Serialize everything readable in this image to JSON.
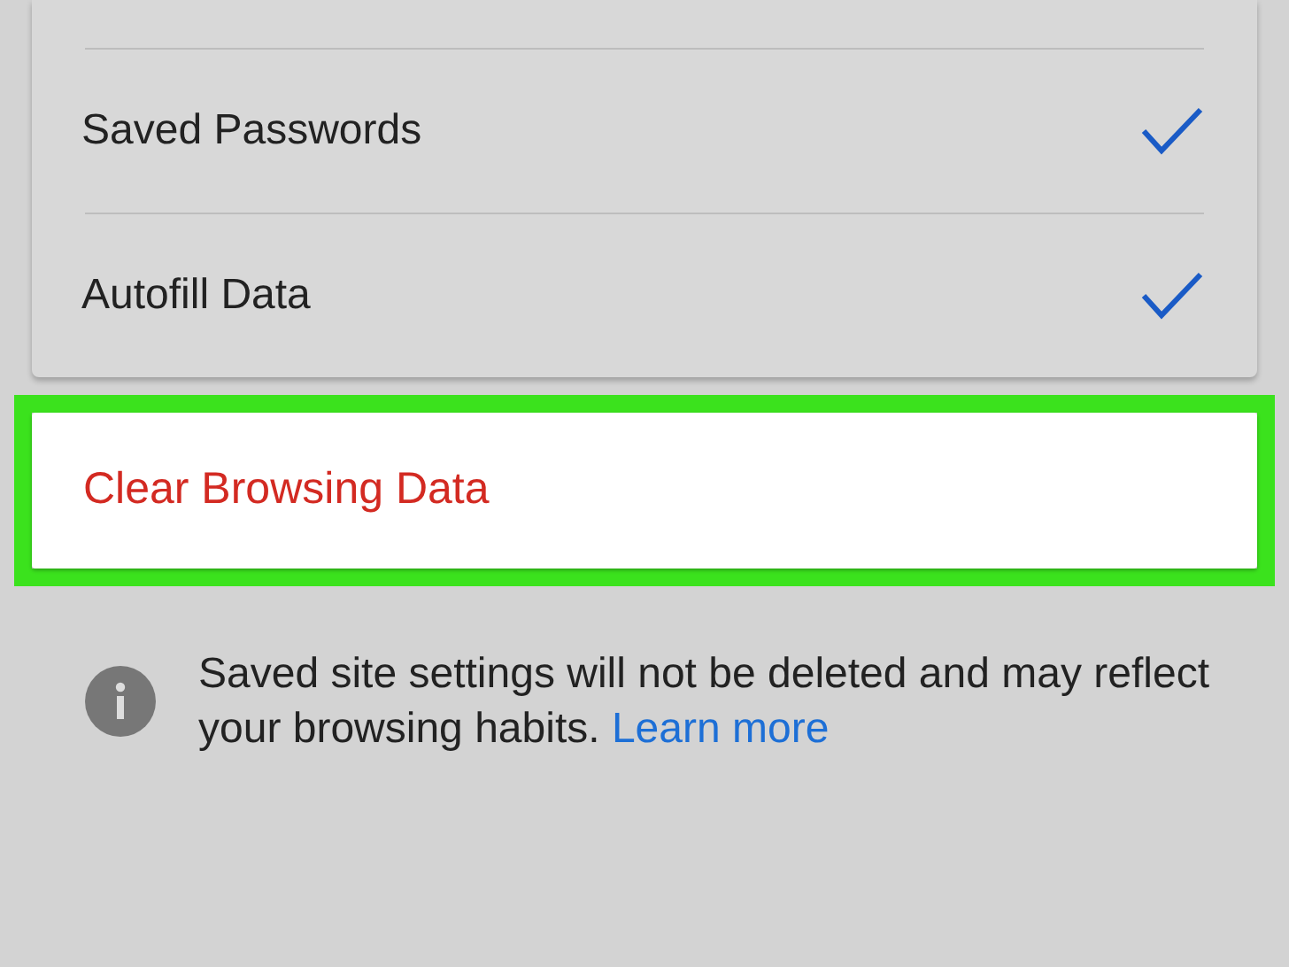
{
  "settings": [
    {
      "label": "Saved Passwords",
      "checked": true
    },
    {
      "label": "Autofill Data",
      "checked": true
    }
  ],
  "action": {
    "label": "Clear Browsing Data",
    "highlighted": true
  },
  "info": {
    "text": "Saved site settings will not be deleted and may reflect your browsing habits.",
    "link": "Learn more"
  }
}
